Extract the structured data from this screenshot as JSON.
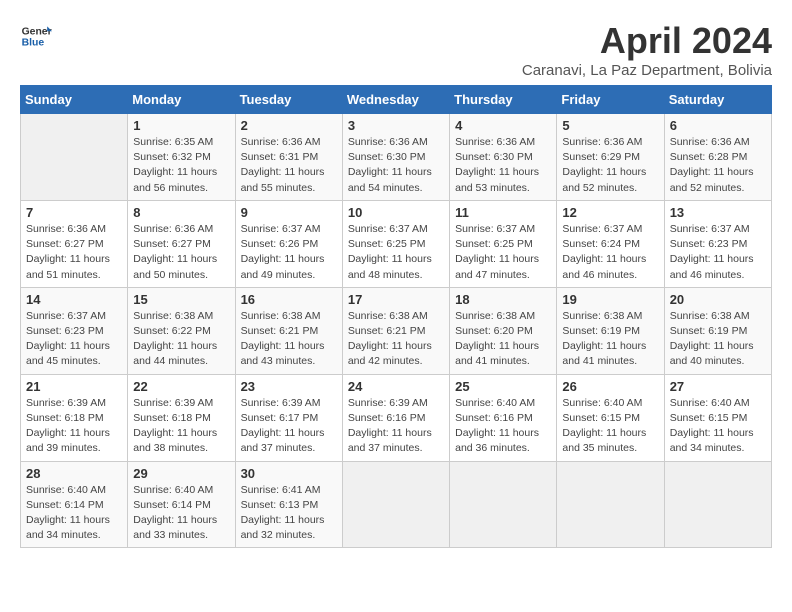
{
  "logo": {
    "line1": "General",
    "line2": "Blue"
  },
  "title": "April 2024",
  "subtitle": "Caranavi, La Paz Department, Bolivia",
  "weekdays": [
    "Sunday",
    "Monday",
    "Tuesday",
    "Wednesday",
    "Thursday",
    "Friday",
    "Saturday"
  ],
  "weeks": [
    [
      {
        "day": "",
        "sunrise": "",
        "sunset": "",
        "daylight": ""
      },
      {
        "day": "1",
        "sunrise": "6:35 AM",
        "sunset": "6:32 PM",
        "daylight": "11 hours and 56 minutes."
      },
      {
        "day": "2",
        "sunrise": "6:36 AM",
        "sunset": "6:31 PM",
        "daylight": "11 hours and 55 minutes."
      },
      {
        "day": "3",
        "sunrise": "6:36 AM",
        "sunset": "6:30 PM",
        "daylight": "11 hours and 54 minutes."
      },
      {
        "day": "4",
        "sunrise": "6:36 AM",
        "sunset": "6:30 PM",
        "daylight": "11 hours and 53 minutes."
      },
      {
        "day": "5",
        "sunrise": "6:36 AM",
        "sunset": "6:29 PM",
        "daylight": "11 hours and 52 minutes."
      },
      {
        "day": "6",
        "sunrise": "6:36 AM",
        "sunset": "6:28 PM",
        "daylight": "11 hours and 52 minutes."
      }
    ],
    [
      {
        "day": "7",
        "sunrise": "6:36 AM",
        "sunset": "6:27 PM",
        "daylight": "11 hours and 51 minutes."
      },
      {
        "day": "8",
        "sunrise": "6:36 AM",
        "sunset": "6:27 PM",
        "daylight": "11 hours and 50 minutes."
      },
      {
        "day": "9",
        "sunrise": "6:37 AM",
        "sunset": "6:26 PM",
        "daylight": "11 hours and 49 minutes."
      },
      {
        "day": "10",
        "sunrise": "6:37 AM",
        "sunset": "6:25 PM",
        "daylight": "11 hours and 48 minutes."
      },
      {
        "day": "11",
        "sunrise": "6:37 AM",
        "sunset": "6:25 PM",
        "daylight": "11 hours and 47 minutes."
      },
      {
        "day": "12",
        "sunrise": "6:37 AM",
        "sunset": "6:24 PM",
        "daylight": "11 hours and 46 minutes."
      },
      {
        "day": "13",
        "sunrise": "6:37 AM",
        "sunset": "6:23 PM",
        "daylight": "11 hours and 46 minutes."
      }
    ],
    [
      {
        "day": "14",
        "sunrise": "6:37 AM",
        "sunset": "6:23 PM",
        "daylight": "11 hours and 45 minutes."
      },
      {
        "day": "15",
        "sunrise": "6:38 AM",
        "sunset": "6:22 PM",
        "daylight": "11 hours and 44 minutes."
      },
      {
        "day": "16",
        "sunrise": "6:38 AM",
        "sunset": "6:21 PM",
        "daylight": "11 hours and 43 minutes."
      },
      {
        "day": "17",
        "sunrise": "6:38 AM",
        "sunset": "6:21 PM",
        "daylight": "11 hours and 42 minutes."
      },
      {
        "day": "18",
        "sunrise": "6:38 AM",
        "sunset": "6:20 PM",
        "daylight": "11 hours and 41 minutes."
      },
      {
        "day": "19",
        "sunrise": "6:38 AM",
        "sunset": "6:19 PM",
        "daylight": "11 hours and 41 minutes."
      },
      {
        "day": "20",
        "sunrise": "6:38 AM",
        "sunset": "6:19 PM",
        "daylight": "11 hours and 40 minutes."
      }
    ],
    [
      {
        "day": "21",
        "sunrise": "6:39 AM",
        "sunset": "6:18 PM",
        "daylight": "11 hours and 39 minutes."
      },
      {
        "day": "22",
        "sunrise": "6:39 AM",
        "sunset": "6:18 PM",
        "daylight": "11 hours and 38 minutes."
      },
      {
        "day": "23",
        "sunrise": "6:39 AM",
        "sunset": "6:17 PM",
        "daylight": "11 hours and 37 minutes."
      },
      {
        "day": "24",
        "sunrise": "6:39 AM",
        "sunset": "6:16 PM",
        "daylight": "11 hours and 37 minutes."
      },
      {
        "day": "25",
        "sunrise": "6:40 AM",
        "sunset": "6:16 PM",
        "daylight": "11 hours and 36 minutes."
      },
      {
        "day": "26",
        "sunrise": "6:40 AM",
        "sunset": "6:15 PM",
        "daylight": "11 hours and 35 minutes."
      },
      {
        "day": "27",
        "sunrise": "6:40 AM",
        "sunset": "6:15 PM",
        "daylight": "11 hours and 34 minutes."
      }
    ],
    [
      {
        "day": "28",
        "sunrise": "6:40 AM",
        "sunset": "6:14 PM",
        "daylight": "11 hours and 34 minutes."
      },
      {
        "day": "29",
        "sunrise": "6:40 AM",
        "sunset": "6:14 PM",
        "daylight": "11 hours and 33 minutes."
      },
      {
        "day": "30",
        "sunrise": "6:41 AM",
        "sunset": "6:13 PM",
        "daylight": "11 hours and 32 minutes."
      },
      {
        "day": "",
        "sunrise": "",
        "sunset": "",
        "daylight": ""
      },
      {
        "day": "",
        "sunrise": "",
        "sunset": "",
        "daylight": ""
      },
      {
        "day": "",
        "sunrise": "",
        "sunset": "",
        "daylight": ""
      },
      {
        "day": "",
        "sunrise": "",
        "sunset": "",
        "daylight": ""
      }
    ]
  ]
}
